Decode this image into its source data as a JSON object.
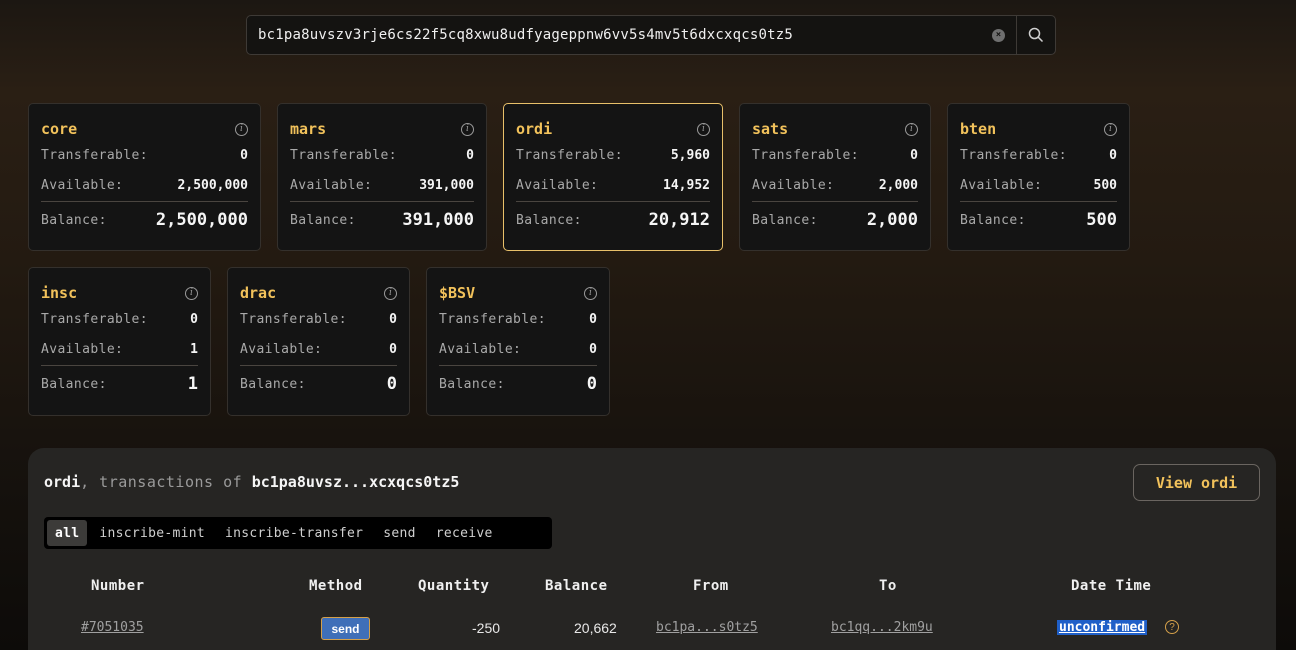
{
  "search": {
    "value": "bc1pa8uvszv3rje6cs22f5cq8xwu8udfyageppnw6vv5s4mv5t6dxcxqcs0tz5"
  },
  "tokens": [
    {
      "ticker": "core",
      "transferable_label": "Transferable:",
      "transferable": "0",
      "available_label": "Available:",
      "available": "2,500,000",
      "balance_label": "Balance:",
      "balance": "2,500,000"
    },
    {
      "ticker": "mars",
      "transferable_label": "Transferable:",
      "transferable": "0",
      "available_label": "Available:",
      "available": "391,000",
      "balance_label": "Balance:",
      "balance": "391,000"
    },
    {
      "ticker": "ordi",
      "transferable_label": "Transferable:",
      "transferable": "5,960",
      "available_label": "Available:",
      "available": "14,952",
      "balance_label": "Balance:",
      "balance": "20,912"
    },
    {
      "ticker": "sats",
      "transferable_label": "Transferable:",
      "transferable": "0",
      "available_label": "Available:",
      "available": "2,000",
      "balance_label": "Balance:",
      "balance": "2,000"
    },
    {
      "ticker": "bten",
      "transferable_label": "Transferable:",
      "transferable": "0",
      "available_label": "Available:",
      "available": "500",
      "balance_label": "Balance:",
      "balance": "500"
    },
    {
      "ticker": "insc",
      "transferable_label": "Transferable:",
      "transferable": "0",
      "available_label": "Available:",
      "available": "1",
      "balance_label": "Balance:",
      "balance": "1"
    },
    {
      "ticker": "drac",
      "transferable_label": "Transferable:",
      "transferable": "0",
      "available_label": "Available:",
      "available": "0",
      "balance_label": "Balance:",
      "balance": "0"
    },
    {
      "ticker": "$BSV",
      "transferable_label": "Transferable:",
      "transferable": "0",
      "available_label": "Available:",
      "available": "0",
      "balance_label": "Balance:",
      "balance": "0"
    }
  ],
  "panel": {
    "ticker": "ordi",
    "middle": ", transactions of ",
    "address_short": "bc1pa8uvsz...xcxqcs0tz5",
    "view_button": "View ordi",
    "tabs": [
      "all",
      "inscribe-mint",
      "inscribe-transfer",
      "send",
      "receive"
    ],
    "columns": [
      "Number",
      "Method",
      "Quantity",
      "Balance",
      "From",
      "To",
      "Date Time"
    ],
    "rows": [
      {
        "number": "#7051035",
        "method": "send",
        "quantity": "-250",
        "balance": "20,662",
        "from": "bc1pa...s0tz5",
        "to": "bc1qq...2km9u",
        "datetime": "unconfirmed "
      }
    ]
  },
  "colors": {
    "accent": "#f2c25b",
    "badge_blue": "#3f6fb8",
    "selected_blue": "#1f5fc8"
  }
}
